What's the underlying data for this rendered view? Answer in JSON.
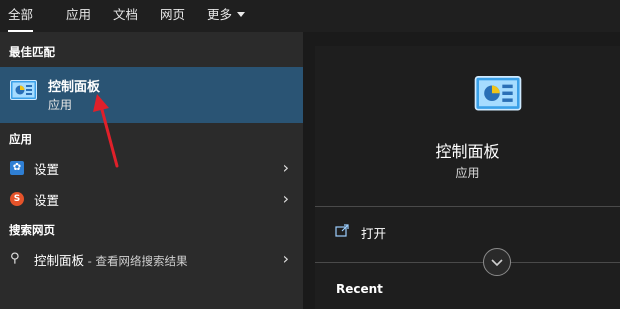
{
  "tabs": [
    {
      "label": "全部",
      "active": true
    },
    {
      "label": "应用"
    },
    {
      "label": "文档"
    },
    {
      "label": "网页"
    },
    {
      "label": "更多"
    }
  ],
  "left": {
    "best_match_heading": "最佳匹配",
    "best_match": {
      "name": "控制面板",
      "type": "应用"
    },
    "apps_heading": "应用",
    "apps": [
      {
        "label": "设置",
        "icon": "settings-gear-icon"
      },
      {
        "label": "设置",
        "icon": "sogou-icon"
      }
    ],
    "web_heading": "搜索网页",
    "web_item": {
      "label": "控制面板",
      "suffix": " - 查看网络搜索结果",
      "icon": "search-icon"
    }
  },
  "right": {
    "title": "控制面板",
    "subtitle": "应用",
    "open_label": "打开",
    "recent_heading": "Recent"
  },
  "colors": {
    "selected_row": "#2a5474",
    "arrow": "#e0202a",
    "accent_blue": "#3aa0e8"
  }
}
